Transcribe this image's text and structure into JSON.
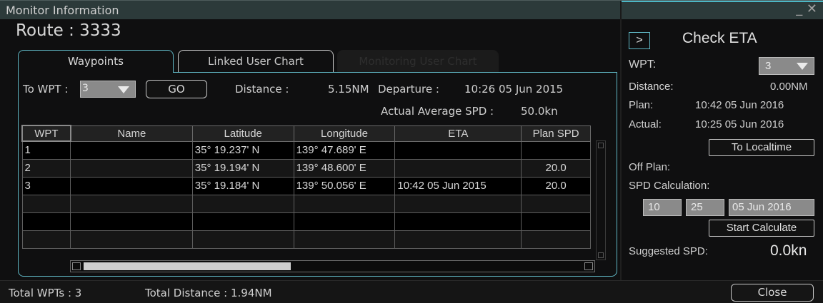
{
  "window": {
    "title": "Monitor Information",
    "close_glyph": "_ ✕"
  },
  "route": {
    "label": "Route : 3333"
  },
  "tabs": {
    "waypoints": "Waypoints",
    "linked": "Linked User Chart",
    "monitoring": "Monitoring User Chart"
  },
  "controls": {
    "to_wpt_label": "To WPT :",
    "to_wpt_value": "3",
    "go_label": "GO",
    "distance_label": "Distance :",
    "distance_value": "5.15NM",
    "departure_label": "Departure :",
    "departure_value": "10:26 05 Jun 2015",
    "avg_spd_label": "Actual Average SPD :",
    "avg_spd_value": "50.0kn"
  },
  "table": {
    "headers": [
      "WPT",
      "Name",
      "Latitude",
      "Longitude",
      "ETA",
      "Plan SPD"
    ],
    "rows": [
      [
        "1",
        "",
        "35° 19.237' N",
        "139° 47.689' E",
        "",
        ""
      ],
      [
        "2",
        "",
        "35° 19.194' N",
        "139° 48.600' E",
        "",
        "20.0"
      ],
      [
        "3",
        "",
        "35° 19.184' N",
        "139° 50.056' E",
        "10:42 05 Jun 2015",
        "20.0"
      ],
      [
        "",
        "",
        "",
        "",
        "",
        ""
      ],
      [
        "",
        "",
        "",
        "",
        "",
        ""
      ],
      [
        "",
        "",
        "",
        "",
        "",
        ""
      ]
    ]
  },
  "status": {
    "total_wpts": "Total WPTs : 3",
    "total_distance": "Total Distance : 1.94NM",
    "close_label": "Close"
  },
  "eta": {
    "toggle_label": ">",
    "title": "Check ETA",
    "wpt_label": "WPT:",
    "wpt_value": "3",
    "distance_label": "Distance:",
    "distance_value": "0.00NM",
    "plan_label": "Plan:",
    "plan_value": "10:42 05 Jun 2016",
    "actual_label": "Actual:",
    "actual_value": "10:25 05 Jun 2016",
    "localtime_label": "To Localtime",
    "off_plan_label": "Off Plan:",
    "spd_calc_label": "SPD Calculation:",
    "calc_hour": "10",
    "calc_minute": "25",
    "calc_date": "05 Jun 2016",
    "start_calc_label": "Start Calculate",
    "suggested_label": "Suggested SPD:",
    "suggested_value": "0.0kn"
  }
}
